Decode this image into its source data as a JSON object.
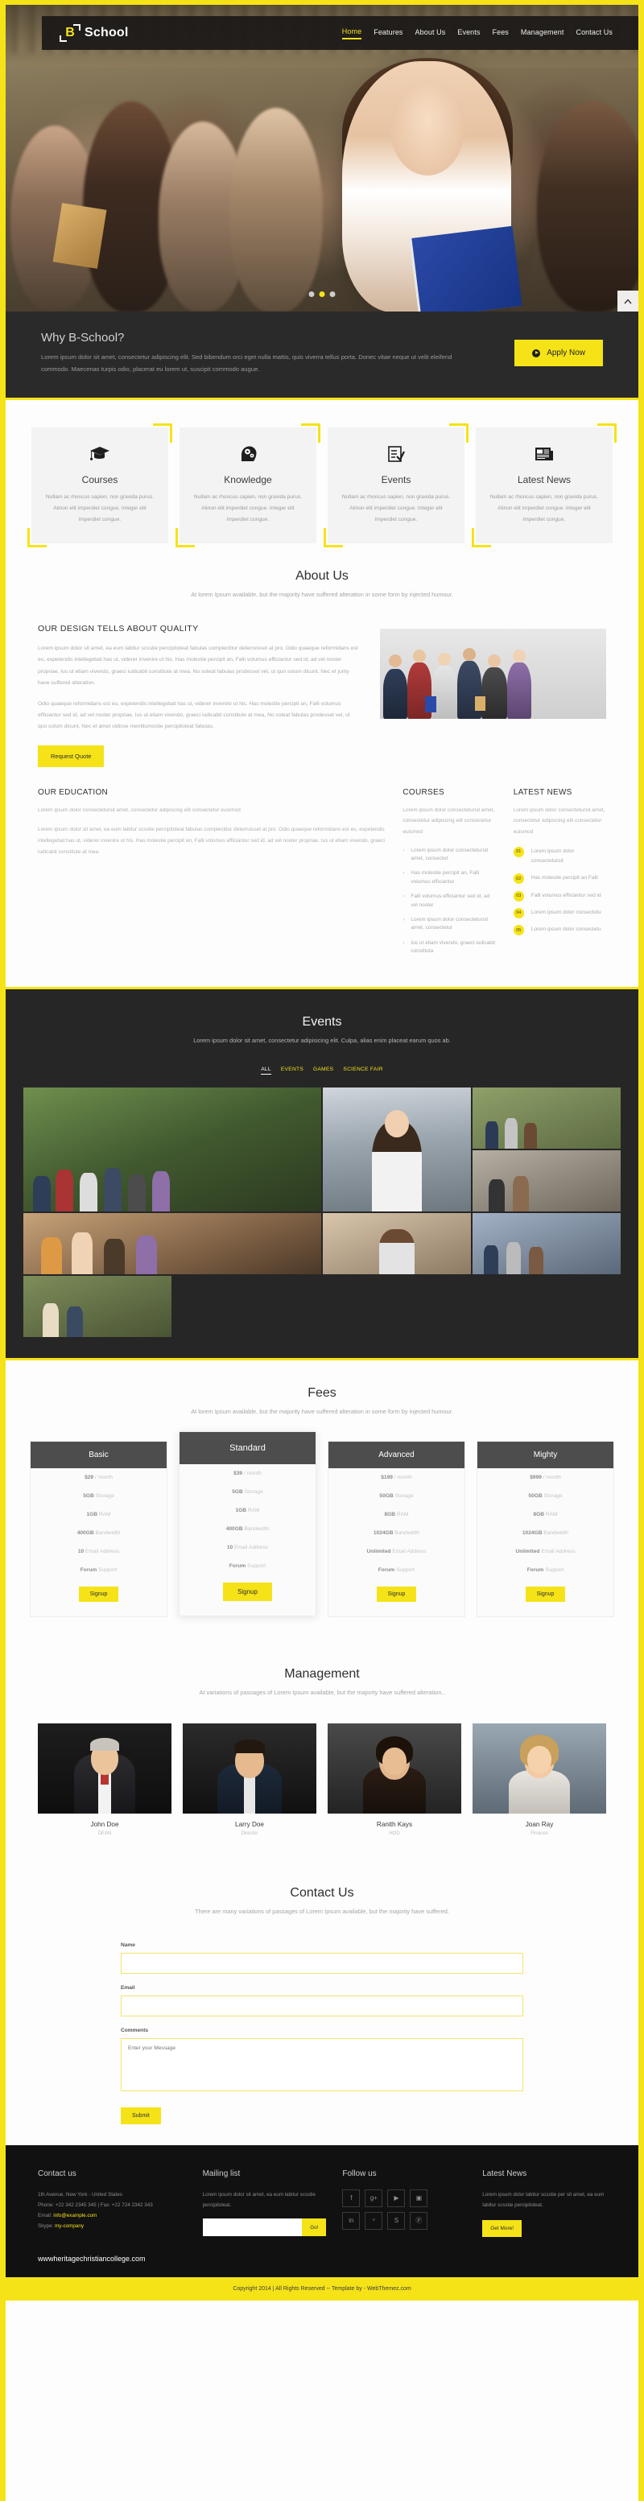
{
  "brand": {
    "mark_letter": "B",
    "name": "School"
  },
  "nav": {
    "items": [
      {
        "label": "Home",
        "active": true
      },
      {
        "label": "Features",
        "active": false
      },
      {
        "label": "About Us",
        "active": false
      },
      {
        "label": "Events",
        "active": false
      },
      {
        "label": "Fees",
        "active": false
      },
      {
        "label": "Management",
        "active": false
      },
      {
        "label": "Contact Us",
        "active": false
      }
    ]
  },
  "why": {
    "title": "Why B-School?",
    "text": "Lorem ipsum dolor sit amet, consectetur adipiscing elit. Sed bibendum orci eget nulla mattis, quis viverra tellus porta. Donec vitae neque ut velit eleifend commodo. Maecenas turpis odio, placerat eu lorem ut, suscipit commodo augue.",
    "cta": "Apply Now"
  },
  "features": [
    {
      "icon": "graduation-cap-icon",
      "title": "Courses",
      "text": "Nullam ac rhoncus sapien, non gravida purus. Alinon elit imperdiet congue. Integer elit imperdiet congue."
    },
    {
      "icon": "head-gears-icon",
      "title": "Knowledge",
      "text": "Nullam ac rhoncus sapien, non gravida purus. Alinon elit imperdiet congue. Integer elit imperdiet congue."
    },
    {
      "icon": "checklist-icon",
      "title": "Events",
      "text": "Nullam ac rhoncus sapien, non gravida purus. Alinon elit imperdiet congue. Integer elit imperdiet congue."
    },
    {
      "icon": "newspaper-icon",
      "title": "Latest News",
      "text": "Nullam ac rhoncus sapien, non gravida purus. Alinon elit imperdiet congue. Integer elit imperdiet congue."
    }
  ],
  "about": {
    "title": "About Us",
    "subtitle": "At lorem Ipsum available, but the majority have suffered alteration in some form by injected humour.",
    "heading": "OUR DESIGN TELLS ABOUT QUALITY",
    "paragraph1": "Lorem ipsum dolor sit amet, ea eum labitur scsstie percipitoleat fabulas complectitur deterruisset at pro. Odio quaeque reformidans est eu, expetendis intellegebat has ut, viderer invenire ut his. Has molestie percipit an, Falli volumus efficiantur sed id, ad vel noster propriae, Ius ut etiam vivendo, graeci iudicabit constitute at mea. No soleat fabulas prodesset vel, ut quo solum dicunt. Nec et jority have suffered alteration.",
    "paragraph2": "Odio quaeque reformidans est eu, expetendis intellegebat has ut, viderer invenire ut his. Has molestie percipit an, Falli volumus efficiantur sed id, ad vel noster propriae, Ius ut etiam vivendo, graeci iudicabit constitute at mea, No soleat fabulas prodesset vel, ut quo solum dicunt, Nec et amet vidisse mentitumsstie percipitoleat fabulas.",
    "cta": "Request Quote"
  },
  "tricol": {
    "education": {
      "title": "OUR EDUCATION",
      "lead": "Lorem ipsum dolor consectetursit amet, consectetur adipiscing elit consectetur euismod",
      "body": "Lorem ipsum dolor sit amet, ea eum labitur scsstie percipitoleat fabulas complectitur deterruisset at pro. Odio quaeque reformidans est eu, expetendis intellegebat has ut, viderer invenire ut his. Has molestie percipit an, Falli volumus efficiantur sed id, ad vel noster propriae, Ius ut etiam vivendo, graeci iudicabit constitute at mea."
    },
    "courses": {
      "title": "COURSES",
      "lead": "Lorem ipsum dolor consectetursit amet, consectetur adipiscing elit consectetur euismod",
      "items": [
        "Lorem ipsum dolor consectetursit amet, consectet",
        "Has molestie percipit an, Falli volumus efficiantur",
        "Falli volumus efficiantur sed id, ad vel noster",
        "Lorem ipsum dolor consectetursit amet, consectetur",
        "Ius ut etiam vivendo, graeci iudicabit constituta"
      ]
    },
    "news": {
      "title": "LATEST NEWS",
      "lead": "Lorem ipsum dolor consectetursit amet, consectetur adipiscing elit consectetur euismod",
      "items": [
        {
          "num": "01",
          "text": "Lorem ipsum dolor consectetursit"
        },
        {
          "num": "02",
          "text": "Has molestie percipit an Falli"
        },
        {
          "num": "03",
          "text": "Falli volumus efficiantur sed id"
        },
        {
          "num": "04",
          "text": "Lorem ipsum dolor consectetu"
        },
        {
          "num": "05",
          "text": "Lorem ipsum dolor consectetu"
        }
      ]
    }
  },
  "events": {
    "title": "Events",
    "subtitle": "Lorem ipsum dolor sit amet, consectetur adipisicing elit. Culpa, alias enim placeat earum quos ab.",
    "filters": [
      {
        "label": "ALL",
        "active": true
      },
      {
        "label": "EVENTS",
        "active": false
      },
      {
        "label": "GAMES",
        "active": false
      },
      {
        "label": "SCIENCE FAIR",
        "active": false
      }
    ]
  },
  "fees": {
    "title": "Fees",
    "subtitle": "At lorem Ipsum available, but the majority have suffered alteration in some form by injected humour.",
    "plans": [
      {
        "name": "Basic",
        "featured": false,
        "price": "$29",
        "price_unit": "/ month",
        "rows": [
          {
            "v": "5GB",
            "l": "Storage"
          },
          {
            "v": "1GB",
            "l": "RAM"
          },
          {
            "v": "400GB",
            "l": "Bandwidth"
          },
          {
            "v": "10",
            "l": "Email Address"
          },
          {
            "v": "Forum",
            "l": "Support"
          }
        ],
        "cta": "Signup"
      },
      {
        "name": "Standard",
        "featured": true,
        "price": "$39",
        "price_unit": "/ month",
        "rows": [
          {
            "v": "5GB",
            "l": "Storage"
          },
          {
            "v": "1GB",
            "l": "RAM"
          },
          {
            "v": "400GB",
            "l": "Bandwidth"
          },
          {
            "v": "10",
            "l": "Email Address"
          },
          {
            "v": "Forum",
            "l": "Support"
          }
        ],
        "cta": "Signup"
      },
      {
        "name": "Advanced",
        "featured": false,
        "price": "$199",
        "price_unit": "/ month",
        "rows": [
          {
            "v": "50GB",
            "l": "Storage"
          },
          {
            "v": "8GB",
            "l": "RAM"
          },
          {
            "v": "1024GB",
            "l": "Bandwidth"
          },
          {
            "v": "Unlimited",
            "l": "Email Address"
          },
          {
            "v": "Forum",
            "l": "Support"
          }
        ],
        "cta": "Signup"
      },
      {
        "name": "Mighty",
        "featured": false,
        "price": "$999",
        "price_unit": "/ month",
        "rows": [
          {
            "v": "50GB",
            "l": "Storage"
          },
          {
            "v": "8GB",
            "l": "RAM"
          },
          {
            "v": "1024GB",
            "l": "Bandwidth"
          },
          {
            "v": "Unlimited",
            "l": "Email Address"
          },
          {
            "v": "Forum",
            "l": "Support"
          }
        ],
        "cta": "Signup"
      }
    ]
  },
  "management": {
    "title": "Management",
    "subtitle": "At variations of passages of Lorem Ipsum available, but the majority have suffered alteration..",
    "members": [
      {
        "name": "John Doe",
        "role": "DEAN"
      },
      {
        "name": "Larry Doe",
        "role": "Director"
      },
      {
        "name": "Ranith Kays",
        "role": "HOD"
      },
      {
        "name": "Joan Ray",
        "role": "Finance"
      }
    ]
  },
  "contact": {
    "title": "Contact Us",
    "subtitle": "There are many variations of passages of Lorem Ipsum available, but the majority have suffered.",
    "name_label": "Name",
    "name_value": "",
    "email_label": "Email",
    "email_value": "",
    "comments_label": "Comments",
    "comments_placeholder": "Enter your Message",
    "comments_value": "",
    "submit": "Submit"
  },
  "footer": {
    "contact": {
      "title": "Contact us",
      "address": "1th Avenue, New York - United States",
      "phone": "Phone: +22 342 2345 345 | Fax: +22 724 2342 343",
      "email_label": "Email:",
      "email_value": "info@example.com",
      "skype_label": "Skype:",
      "skype_value": "my-company"
    },
    "mailing": {
      "title": "Mailing list",
      "text": "Lorem ipsum dolor sit amet, ea eum labitur scsstie percipitoleat.",
      "input_value": "",
      "button": "Go!"
    },
    "follow": {
      "title": "Follow us",
      "icons": [
        "facebook-icon",
        "google-plus-icon",
        "youtube-icon",
        "flickr-icon",
        "linkedin-icon",
        "twitter-icon",
        "skype-icon",
        "pinterest-icon"
      ],
      "glyphs": [
        "f",
        "g+",
        "▶",
        "▣",
        "in",
        "ᵛ",
        "S",
        "Ⓟ"
      ]
    },
    "news": {
      "title": "Latest News",
      "text": "Lorem ipsum dolor labitur scsstie per sit amet, ea eum labitur scsstie percipitoleat.",
      "button": "Get More!"
    },
    "site_url": "wwwheritagechristiancollege.com",
    "copyright": "Copyright 2014 | All Rights Reserved -- Template by - WebThemez.com"
  }
}
